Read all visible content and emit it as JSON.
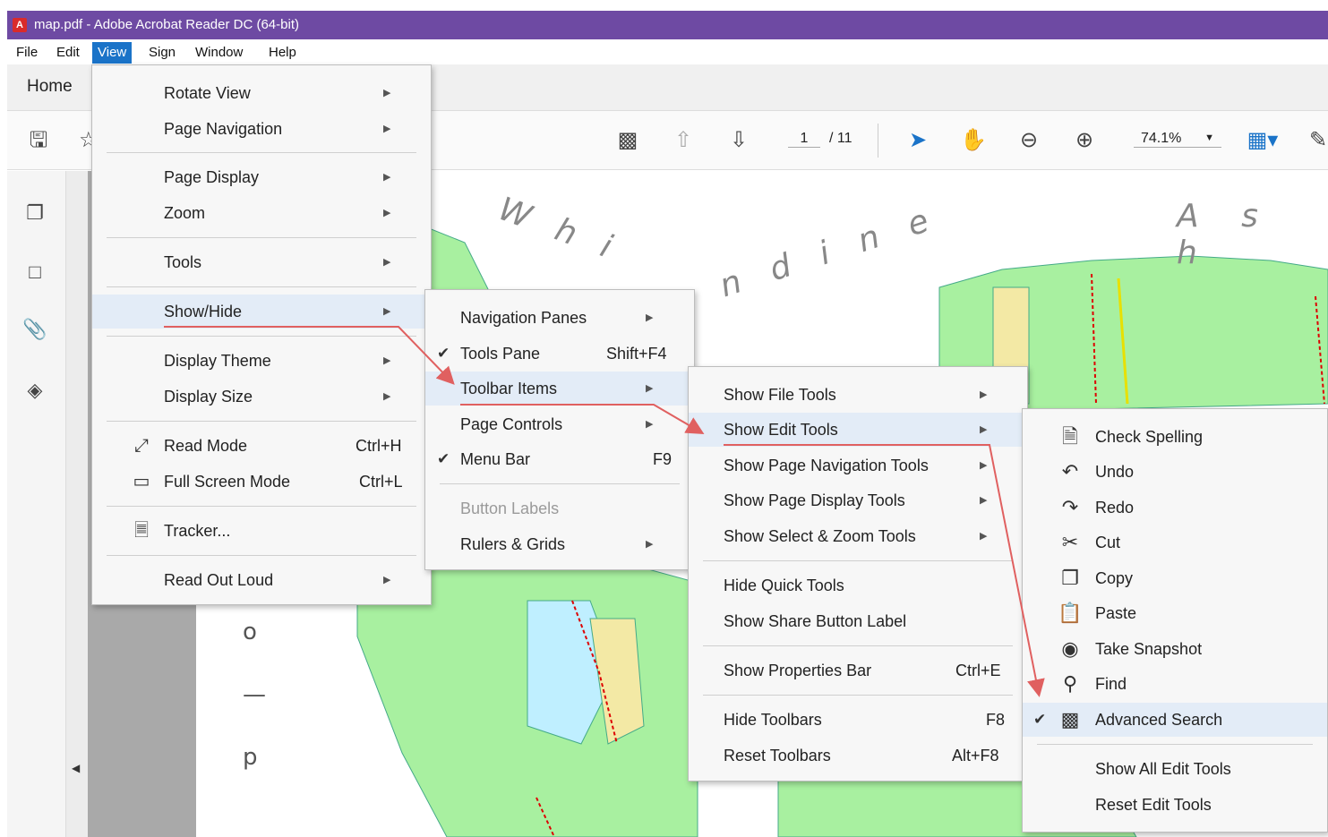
{
  "window": {
    "title": "map.pdf - Adobe Acrobat Reader DC (64-bit)"
  },
  "menubar": {
    "items": [
      "File",
      "Edit",
      "View",
      "Sign",
      "Window",
      "Help"
    ]
  },
  "tabbar": {
    "home": "Home"
  },
  "toolbar": {
    "page_current": "1",
    "page_total": "/ 11",
    "zoom": "74.1%"
  },
  "map": {
    "word1": "W h i",
    "word2": "n d i n e",
    "word3": "A  s  h"
  },
  "view_menu": {
    "items": [
      {
        "label": "Rotate View",
        "submenu": true
      },
      {
        "label": "Page Navigation",
        "submenu": true
      },
      {
        "label": "Page Display",
        "submenu": true
      },
      {
        "label": "Zoom",
        "submenu": true
      },
      {
        "label": "Tools",
        "submenu": true
      },
      {
        "label": "Show/Hide",
        "submenu": true
      },
      {
        "label": "Display Theme",
        "submenu": true
      },
      {
        "label": "Display Size",
        "submenu": true
      },
      {
        "label": "Read Mode",
        "shortcut": "Ctrl+H"
      },
      {
        "label": "Full Screen Mode",
        "shortcut": "Ctrl+L"
      },
      {
        "label": "Tracker..."
      },
      {
        "label": "Read Out Loud",
        "submenu": true
      }
    ]
  },
  "showhide_menu": {
    "items": [
      {
        "label": "Navigation Panes",
        "submenu": true
      },
      {
        "label": "Tools Pane",
        "shortcut": "Shift+F4",
        "checked": true
      },
      {
        "label": "Toolbar Items",
        "submenu": true
      },
      {
        "label": "Page Controls",
        "submenu": true
      },
      {
        "label": "Menu Bar",
        "shortcut": "F9",
        "checked": true
      },
      {
        "label": "Button Labels",
        "disabled": true
      },
      {
        "label": "Rulers & Grids",
        "submenu": true
      }
    ]
  },
  "toolbar_items_menu": {
    "items": [
      {
        "label": "Show File Tools",
        "submenu": true
      },
      {
        "label": "Show Edit Tools",
        "submenu": true
      },
      {
        "label": "Show Page Navigation Tools",
        "submenu": true
      },
      {
        "label": "Show Page Display Tools",
        "submenu": true
      },
      {
        "label": "Show Select & Zoom Tools",
        "submenu": true
      },
      {
        "label": "Hide Quick Tools"
      },
      {
        "label": "Show Share Button Label"
      },
      {
        "label": "Show Properties Bar",
        "shortcut": "Ctrl+E"
      },
      {
        "label": "Hide Toolbars",
        "shortcut": "F8"
      },
      {
        "label": "Reset Toolbars",
        "shortcut": "Alt+F8"
      }
    ]
  },
  "edit_tools_menu": {
    "items": [
      {
        "label": "Check Spelling",
        "icon": "spellcheck-icon"
      },
      {
        "label": "Undo",
        "icon": "undo-icon"
      },
      {
        "label": "Redo",
        "icon": "redo-icon"
      },
      {
        "label": "Cut",
        "icon": "scissors-icon"
      },
      {
        "label": "Copy",
        "icon": "copy-icon"
      },
      {
        "label": "Paste",
        "icon": "clipboard-icon"
      },
      {
        "label": "Take Snapshot",
        "icon": "camera-icon"
      },
      {
        "label": "Find",
        "icon": "magnifier-icon",
        "checked": true
      },
      {
        "label": "Advanced Search",
        "icon": "binoculars-icon",
        "checked": true
      },
      {
        "label": "Show All Edit Tools"
      },
      {
        "label": "Reset Edit Tools"
      }
    ]
  },
  "colors": {
    "title_bar": "#6e4aa3",
    "menu_highlight": "#1a73c8",
    "annotation_arrow": "#e06060",
    "map_green": "#a8f0a0"
  }
}
